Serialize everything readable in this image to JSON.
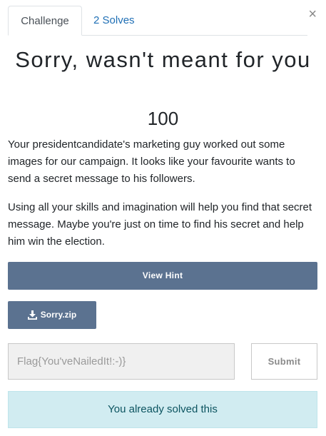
{
  "tabs": {
    "challenge_label": "Challenge",
    "solves_label": "2 Solves"
  },
  "close_glyph": "×",
  "challenge": {
    "title": "Sorry, wasn't meant for you",
    "value": "100",
    "description": [
      "Your presidentcandidate's marketing guy worked out some images for our campaign. It looks like your favourite wants to send a secret message to his followers.",
      "Using all your skills and imagination will help you find that secret message. Maybe you're just on time to find his secret and help him win the election."
    ]
  },
  "hint_button_label": "View Hint",
  "file": {
    "icon": "download-icon",
    "label": "Sorry.zip"
  },
  "flag_input": {
    "value": "Flag{You'veNailedIt!:-)}",
    "placeholder": "Flag"
  },
  "submit_label": "Submit",
  "notice": "You already solved this",
  "colors": {
    "button_bg": "#5b7290",
    "tab_link": "#1f6fb5",
    "notice_bg": "#d1ecf1",
    "notice_text": "#0c5460"
  }
}
